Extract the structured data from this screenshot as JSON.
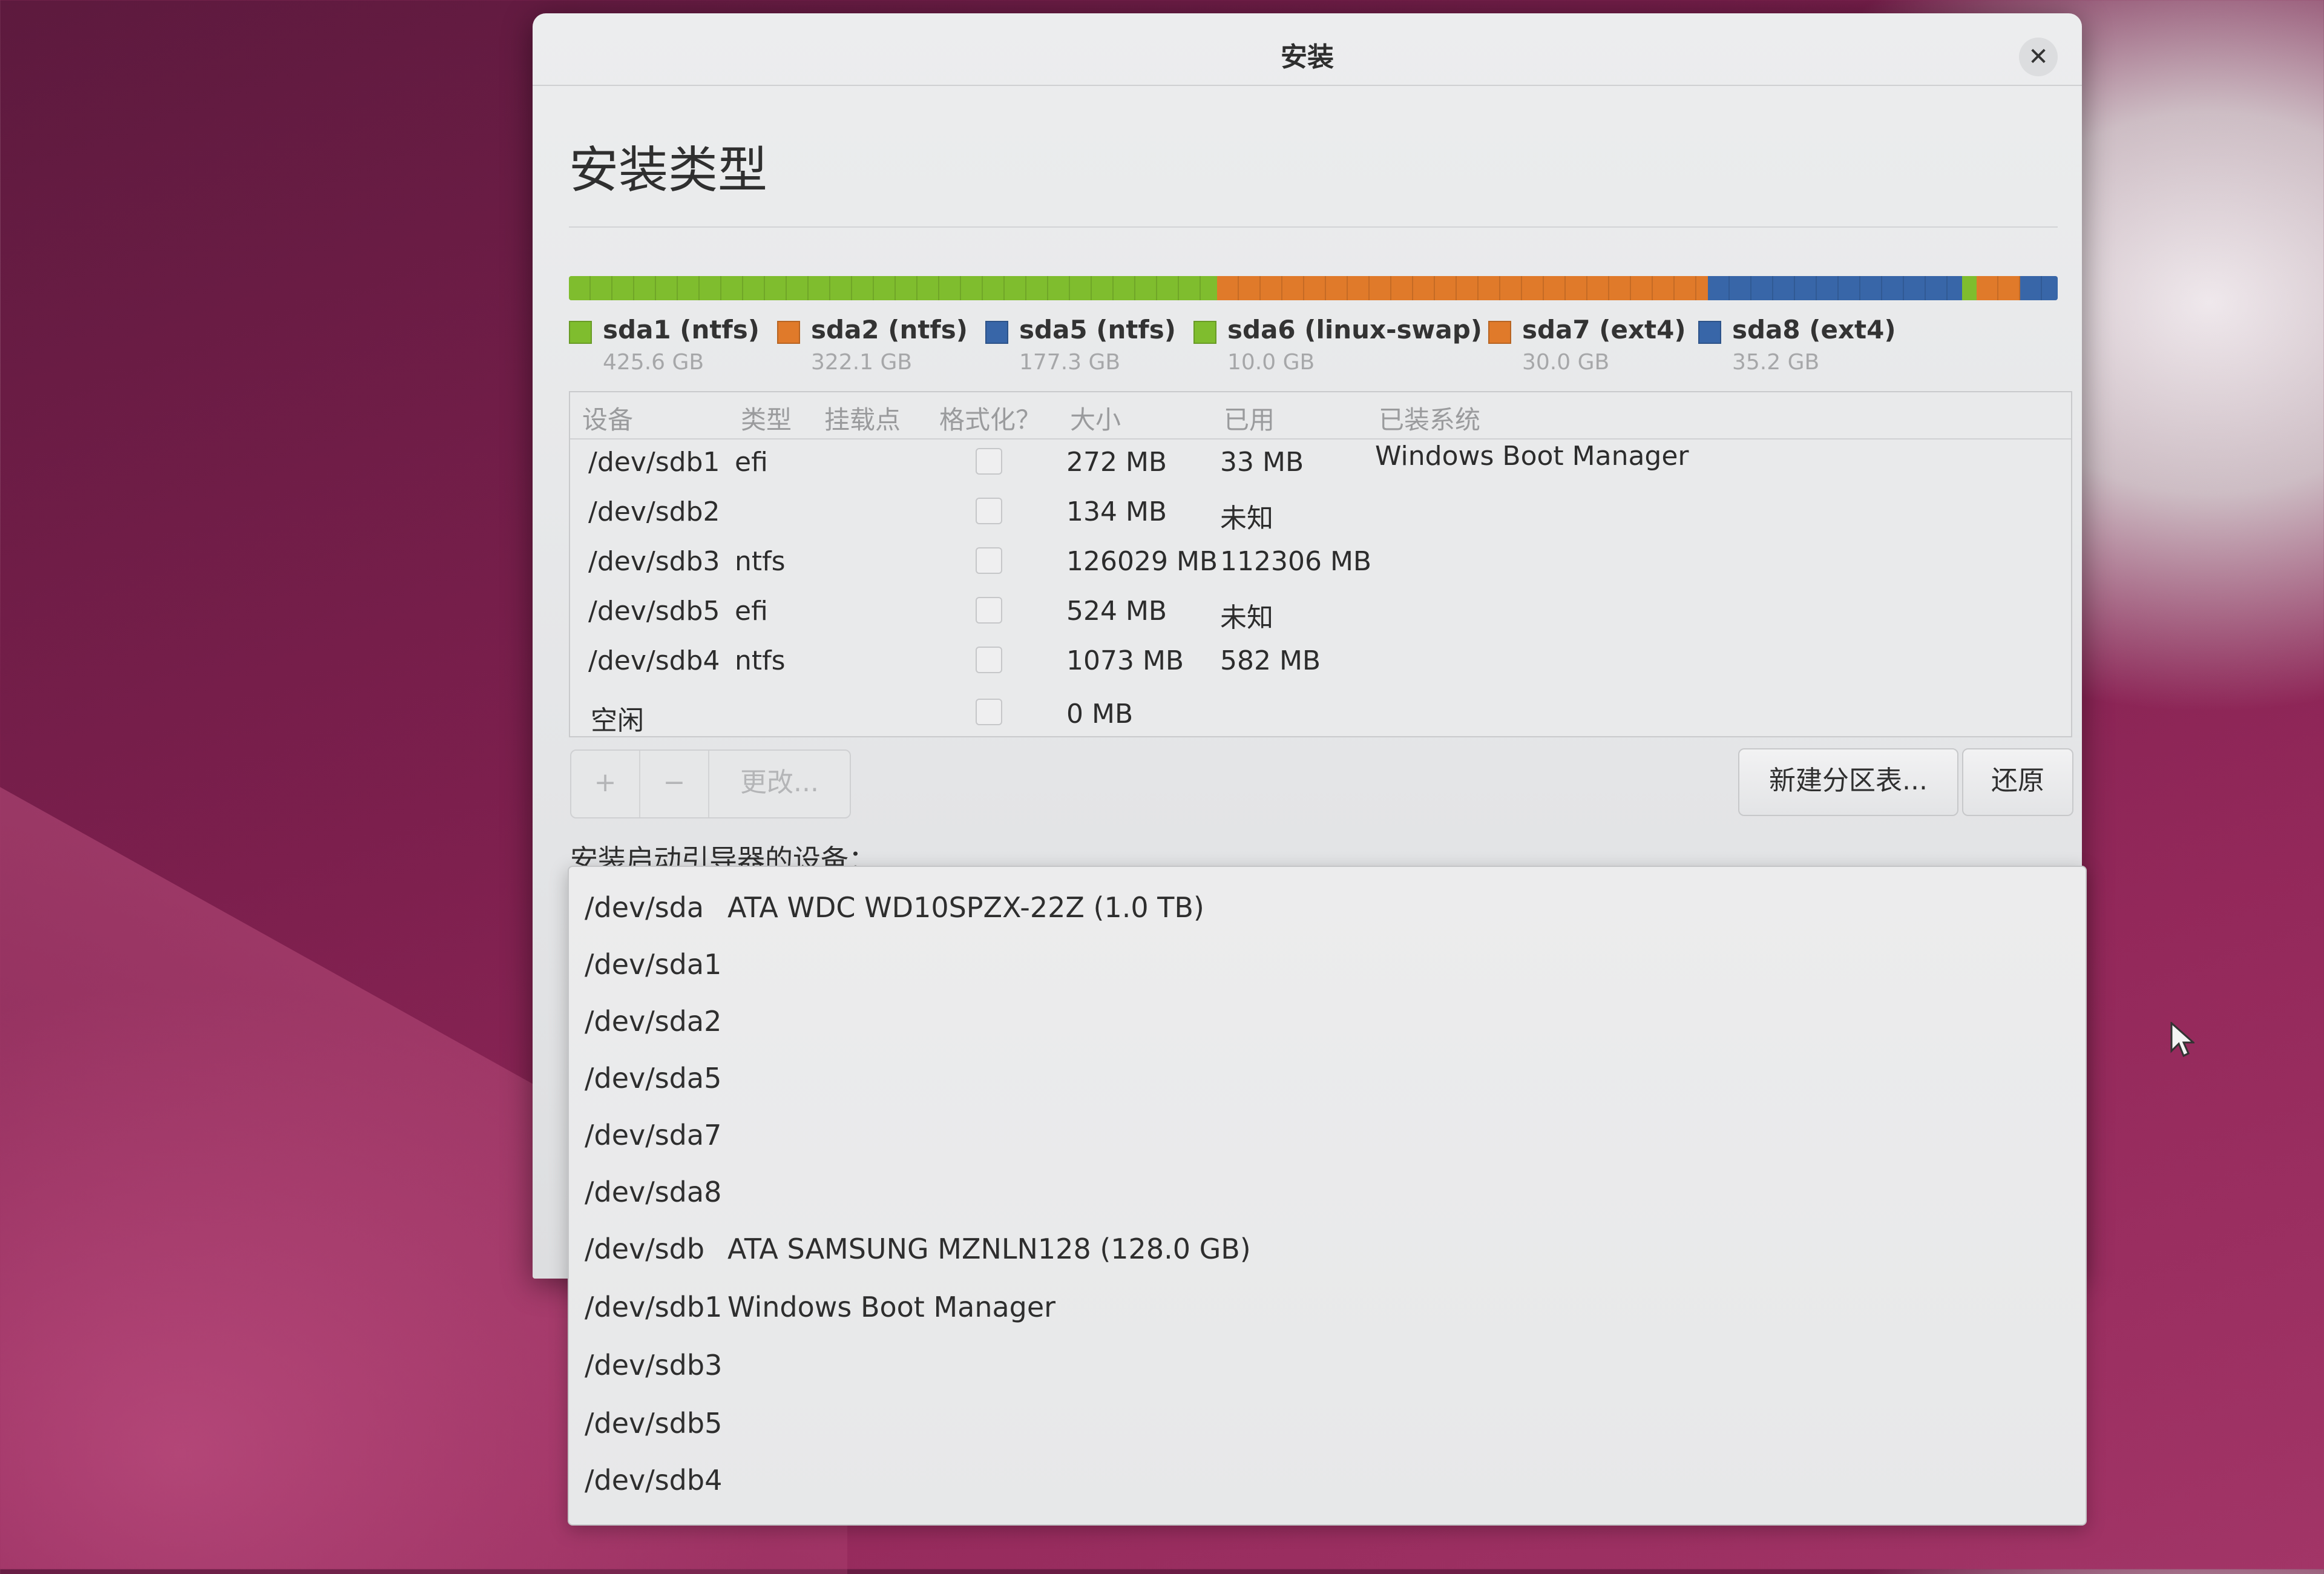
{
  "window": {
    "title": "安装",
    "close_icon": "close-icon"
  },
  "page_title": "安装类型",
  "partition_bar": [
    {
      "name": "sda1 (ntfs)",
      "size": "425.6 GB",
      "color": "#7fbd2e"
    },
    {
      "name": "sda2 (ntfs)",
      "size": "322.1 GB",
      "color": "#e07a2a"
    },
    {
      "name": "sda5 (ntfs)",
      "size": "177.3 GB",
      "color": "#3866a8"
    },
    {
      "name": "sda6 (linux-swap)",
      "size": "10.0 GB",
      "color": "#7fbd2e"
    },
    {
      "name": "sda7 (ext4)",
      "size": "30.0 GB",
      "color": "#e07a2a"
    },
    {
      "name": "sda8 (ext4)",
      "size": "35.2 GB",
      "color": "#3866a8"
    }
  ],
  "table": {
    "headers": {
      "device": "设备",
      "type": "类型",
      "mount": "挂载点",
      "format": "格式化？",
      "size": "大小",
      "used": "已用",
      "system": "已装系统"
    },
    "rows": [
      {
        "device": "/dev/sdb1",
        "type": "efi",
        "mount": "",
        "size": "272 MB",
        "used": "33 MB",
        "system": "Windows Boot Manager"
      },
      {
        "device": "/dev/sdb2",
        "type": "",
        "mount": "",
        "size": "134 MB",
        "used": "未知",
        "system": ""
      },
      {
        "device": "/dev/sdb3",
        "type": "ntfs",
        "mount": "",
        "size": "126029 MB",
        "used": "112306 MB",
        "system": ""
      },
      {
        "device": "/dev/sdb5",
        "type": "efi",
        "mount": "",
        "size": "524 MB",
        "used": "未知",
        "system": ""
      },
      {
        "device": "/dev/sdb4",
        "type": "ntfs",
        "mount": "",
        "size": "1073 MB",
        "used": "582 MB",
        "system": ""
      },
      {
        "device": "空闲",
        "type": "",
        "mount": "",
        "size": "0 MB",
        "used": "",
        "system": ""
      }
    ]
  },
  "toolbar": {
    "add_label": "+",
    "remove_label": "−",
    "change_label": "更改...",
    "new_table_label": "新建分区表...",
    "revert_label": "还原"
  },
  "bootloader": {
    "label": "安装启动引导器的设备：",
    "devices": [
      {
        "device": "/dev/sda",
        "desc": "ATA WDC WD10SPZX-22Z (1.0 TB)"
      },
      {
        "device": "/dev/sda1",
        "desc": ""
      },
      {
        "device": "/dev/sda2",
        "desc": ""
      },
      {
        "device": "/dev/sda5",
        "desc": ""
      },
      {
        "device": "/dev/sda7",
        "desc": ""
      },
      {
        "device": "/dev/sda8",
        "desc": ""
      },
      {
        "device": "/dev/sdb",
        "desc": "ATA SAMSUNG MZNLN128 (128.0 GB)"
      },
      {
        "device": "/dev/sdb1",
        "desc": "Windows Boot Manager"
      },
      {
        "device": "/dev/sdb3",
        "desc": ""
      },
      {
        "device": "/dev/sdb5",
        "desc": ""
      },
      {
        "device": "/dev/sdb4",
        "desc": ""
      }
    ]
  },
  "pointer_icon": "mouse-pointer-icon"
}
